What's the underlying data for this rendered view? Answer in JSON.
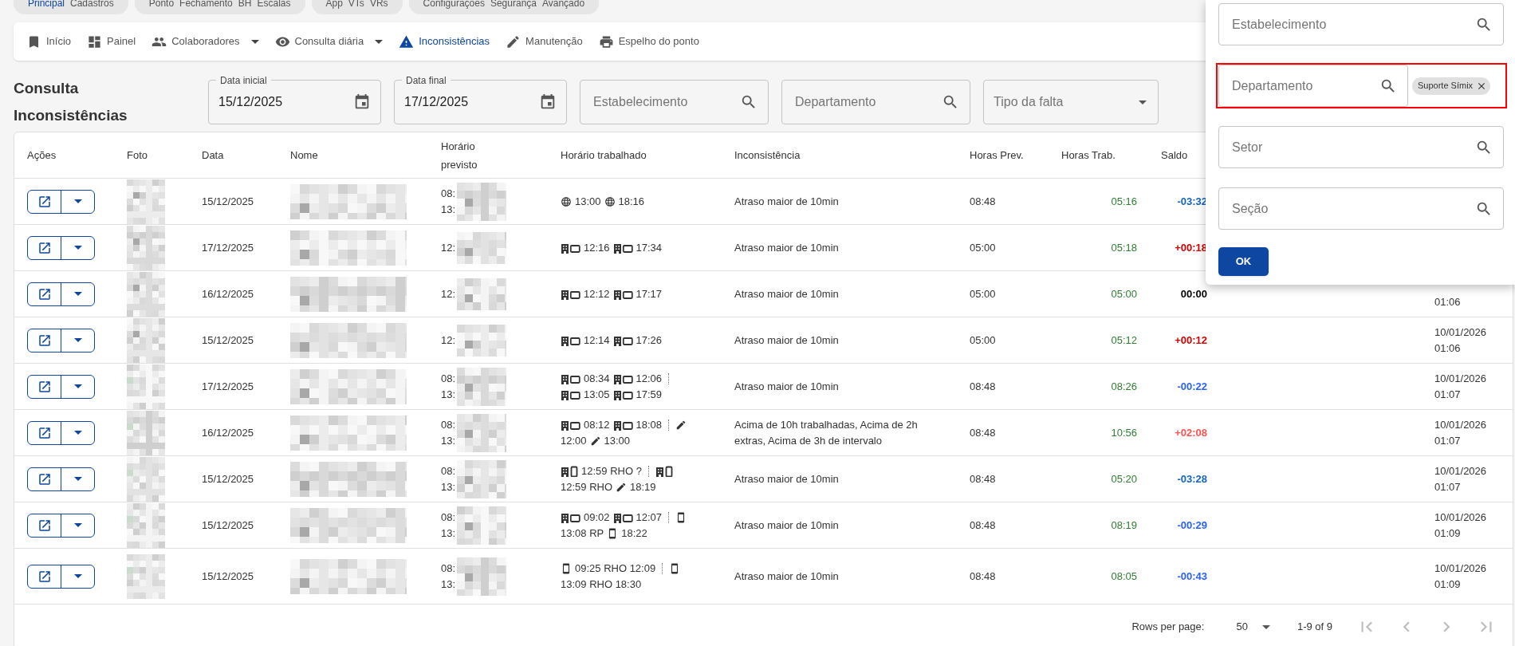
{
  "module_groups": [
    {
      "items": [
        {
          "label": "Principal",
          "selected": true
        },
        {
          "label": "Cadastros",
          "selected": false
        }
      ]
    },
    {
      "items": [
        {
          "label": "Ponto",
          "selected": false
        },
        {
          "label": "Fechamento",
          "selected": false
        },
        {
          "label": "BH",
          "selected": false
        },
        {
          "label": "Escalas",
          "selected": false
        }
      ]
    },
    {
      "items": [
        {
          "label": "App",
          "selected": false
        },
        {
          "label": "VTs",
          "selected": false
        },
        {
          "label": "VRs",
          "selected": false
        }
      ]
    },
    {
      "items": [
        {
          "label": "Configurações",
          "selected": false
        },
        {
          "label": "Segurança",
          "selected": false
        },
        {
          "label": "Avançado",
          "selected": false
        }
      ]
    }
  ],
  "nav": [
    {
      "label": "Início",
      "dropdown": false,
      "selected": false
    },
    {
      "label": "Painel",
      "dropdown": false,
      "selected": false
    },
    {
      "label": "Colaboradores",
      "dropdown": true,
      "selected": false
    },
    {
      "label": "Consulta diária",
      "dropdown": true,
      "selected": false
    },
    {
      "label": "Inconsistências",
      "dropdown": false,
      "selected": true
    },
    {
      "label": "Manutenção",
      "dropdown": false,
      "selected": false
    },
    {
      "label": "Espelho do ponto",
      "dropdown": false,
      "selected": false
    }
  ],
  "page_title": "Consulta Inconsistências",
  "filters": [
    {
      "kind": "date",
      "label": "Data inicial",
      "value": "15/12/2025"
    },
    {
      "kind": "date",
      "label": "Data final",
      "value": "17/12/2025"
    },
    {
      "kind": "search",
      "placeholder": "Estabelecimento"
    },
    {
      "kind": "search",
      "placeholder": "Departamento"
    },
    {
      "kind": "select",
      "placeholder": "Tipo da falta"
    }
  ],
  "table": {
    "columns": [
      "Ações",
      "Foto",
      "Data",
      "Nome",
      "Horário previsto",
      "Horário trabalhado",
      "Inconsistência",
      "Horas Prev.",
      "Horas Trab.",
      "Saldo"
    ],
    "rows": [
      {
        "date": "15/12/2025",
        "planned": [
          "08:",
          "13:"
        ],
        "worked": [
          [
            {
              "kind": "globe"
            },
            {
              "kind": "text",
              "text": "13:00"
            },
            {
              "kind": "globe"
            },
            {
              "kind": "text",
              "text": "18:16"
            }
          ]
        ],
        "issue": "Atraso maior de 10min",
        "hours_planned": "08:48",
        "hours_worked": "05:16",
        "balance": "-03:32",
        "color": "#1565c0"
      },
      {
        "date": "17/12/2025",
        "planned": [
          "12:"
        ],
        "worked": [
          [
            {
              "kind": "office"
            },
            {
              "kind": "text",
              "text": "12:16"
            },
            {
              "kind": "office"
            },
            {
              "kind": "text",
              "text": "17:34"
            }
          ]
        ],
        "issue": "Atraso maior de 10min",
        "hours_planned": "05:00",
        "hours_worked": "05:18",
        "balance": "+00:18",
        "color": "#d50000"
      },
      {
        "date": "16/12/2025",
        "planned": [
          "12:"
        ],
        "worked": [
          [
            {
              "kind": "office"
            },
            {
              "kind": "text",
              "text": "12:12"
            },
            {
              "kind": "office"
            },
            {
              "kind": "text",
              "text": "17:17"
            }
          ]
        ],
        "issue": "Atraso maior de 10min",
        "hours_planned": "05:00",
        "hours_worked": "05:00",
        "balance": "00:00",
        "color": "#000000",
        "registered": [
          "01:06"
        ]
      },
      {
        "date": "15/12/2025",
        "planned": [
          "12:"
        ],
        "worked": [
          [
            {
              "kind": "office"
            },
            {
              "kind": "text",
              "text": "12:14"
            },
            {
              "kind": "office"
            },
            {
              "kind": "text",
              "text": "17:26"
            }
          ]
        ],
        "issue": "Atraso maior de 10min",
        "hours_planned": "05:00",
        "hours_worked": "05:12",
        "balance": "+00:12",
        "color": "#d50000",
        "registered": [
          "10/01/2026",
          "01:06"
        ]
      },
      {
        "date": "17/12/2025",
        "planned": [
          "08:",
          "13:"
        ],
        "worked": [
          [
            {
              "kind": "office"
            },
            {
              "kind": "text",
              "text": "08:34"
            },
            {
              "kind": "office"
            },
            {
              "kind": "text",
              "text": "12:06"
            },
            {
              "kind": "divider"
            }
          ],
          [
            {
              "kind": "office"
            },
            {
              "kind": "text",
              "text": "13:05"
            },
            {
              "kind": "office"
            },
            {
              "kind": "text",
              "text": "17:59"
            }
          ]
        ],
        "issue": "Atraso maior de 10min",
        "hours_planned": "08:48",
        "hours_worked": "08:26",
        "balance": "-00:22",
        "color": "#2962ff",
        "registered": [
          "10/01/2026",
          "01:07"
        ]
      },
      {
        "date": "16/12/2025",
        "planned": [
          "08:",
          "13:"
        ],
        "worked": [
          [
            {
              "kind": "office"
            },
            {
              "kind": "text",
              "text": "08:12"
            },
            {
              "kind": "office"
            },
            {
              "kind": "text",
              "text": "18:08"
            },
            {
              "kind": "divider"
            },
            {
              "kind": "pencil"
            }
          ],
          [
            {
              "kind": "text",
              "text": "12:00"
            },
            {
              "kind": "pencil"
            },
            {
              "kind": "text",
              "text": "13:00"
            }
          ]
        ],
        "issue": "Acima de 10h trabalhadas, Acima de 2h extras, Acima de 3h de intervalo",
        "hours_planned": "08:48",
        "hours_worked": "10:56",
        "balance": "+02:08",
        "color": "#ff5252",
        "registered": [
          "10/01/2026",
          "01:07"
        ]
      },
      {
        "date": "15/12/2025",
        "planned": [
          "08:",
          "13:"
        ],
        "worked": [
          [
            {
              "kind": "officemobile"
            },
            {
              "kind": "text",
              "text": "12:59 RHO ?"
            },
            {
              "kind": "divider"
            },
            {
              "kind": "officemobile"
            }
          ],
          [
            {
              "kind": "text",
              "text": "12:59 RHO"
            },
            {
              "kind": "pencil"
            },
            {
              "kind": "text",
              "text": "18:19"
            }
          ]
        ],
        "issue": "Atraso maior de 10min",
        "hours_planned": "08:48",
        "hours_worked": "05:20",
        "balance": "-03:28",
        "color": "#1565c0",
        "registered": [
          "10/01/2026",
          "01:07"
        ]
      },
      {
        "date": "15/12/2025",
        "planned": [
          "08:",
          "13:"
        ],
        "worked": [
          [
            {
              "kind": "office"
            },
            {
              "kind": "text",
              "text": "09:02"
            },
            {
              "kind": "office"
            },
            {
              "kind": "text",
              "text": "12:07"
            },
            {
              "kind": "divider"
            },
            {
              "kind": "mobile"
            }
          ],
          [
            {
              "kind": "text",
              "text": "13:08 RP"
            },
            {
              "kind": "mobile"
            },
            {
              "kind": "text",
              "text": "18:22"
            }
          ]
        ],
        "issue": "Atraso maior de 10min",
        "hours_planned": "08:48",
        "hours_worked": "08:19",
        "balance": "-00:29",
        "color": "#2962ff",
        "registered": [
          "10/01/2026",
          "01:09"
        ]
      },
      {
        "date": "15/12/2025",
        "planned": [
          "08:",
          "13:"
        ],
        "worked": [
          [
            {
              "kind": "mobile"
            },
            {
              "kind": "text",
              "text": "09:25 RHO 12:09"
            },
            {
              "kind": "divider"
            },
            {
              "kind": "mobile"
            }
          ],
          [
            {
              "kind": "text",
              "text": "13:09 RHO 18:30"
            }
          ]
        ],
        "issue": "Atraso maior de 10min",
        "hours_planned": "08:48",
        "hours_worked": "08:05",
        "balance": "-00:43",
        "color": "#2962ff",
        "registered": [
          "10/01/2026",
          "01:09"
        ]
      }
    ]
  },
  "pagination": {
    "rows_per_page_label": "Rows per page:",
    "rows_per_page": "50",
    "range": "1-9 of 9",
    "buttons": [
      {
        "disabled": true
      },
      {
        "disabled": true
      },
      {
        "disabled": true
      },
      {
        "disabled": true
      }
    ]
  },
  "filter_panel": {
    "fields": [
      {
        "placeholder": "Estabelecimento",
        "highlighted": false
      },
      {
        "placeholder": "Departamento",
        "highlighted": true,
        "chips": [
          "Suporte Símix"
        ]
      },
      {
        "placeholder": "Setor",
        "highlighted": false
      },
      {
        "placeholder": "Seção",
        "highlighted": false
      }
    ],
    "ok_button": "OK"
  }
}
